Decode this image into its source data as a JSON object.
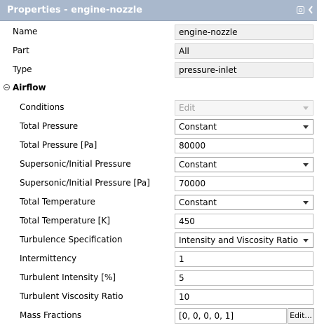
{
  "header": {
    "title": "Properties - engine-nozzle",
    "pin_icon": "pin-icon",
    "collapse_icon": "chevron-left-icon"
  },
  "general": [
    {
      "label": "Name",
      "value": "engine-nozzle"
    },
    {
      "label": "Part",
      "value": "All"
    },
    {
      "label": "Type",
      "value": "pressure-inlet"
    }
  ],
  "airflow": {
    "section_label": "Airflow",
    "conditions": {
      "label": "Conditions",
      "value": "Edit"
    },
    "total_pressure": {
      "label": "Total Pressure",
      "value": "Constant"
    },
    "total_pressure_pa": {
      "label": "Total Pressure [Pa]",
      "value": "80000"
    },
    "supersonic_pressure": {
      "label": "Supersonic/Initial Pressure",
      "value": "Constant"
    },
    "supersonic_pressure_pa": {
      "label": "Supersonic/Initial Pressure [Pa]",
      "value": "70000"
    },
    "total_temperature": {
      "label": "Total Temperature",
      "value": "Constant"
    },
    "total_temperature_k": {
      "label": "Total Temperature [K]",
      "value": "450"
    },
    "turbulence_spec": {
      "label": "Turbulence Specification",
      "value": "Intensity and Viscosity Ratio"
    },
    "intermittency": {
      "label": "Intermittency",
      "value": "1"
    },
    "turbulent_intensity": {
      "label": "Turbulent Intensity [%]",
      "value": "5"
    },
    "turbulent_viscosity_ratio": {
      "label": "Turbulent Viscosity Ratio",
      "value": "10"
    },
    "mass_fractions": {
      "label": "Mass Fractions",
      "value": "[0, 0, 0, 0, 1]",
      "button": "Edit..."
    }
  },
  "colors": {
    "titlebar": "#a9b8cc",
    "readonly_bg": "#f0f0f0"
  }
}
